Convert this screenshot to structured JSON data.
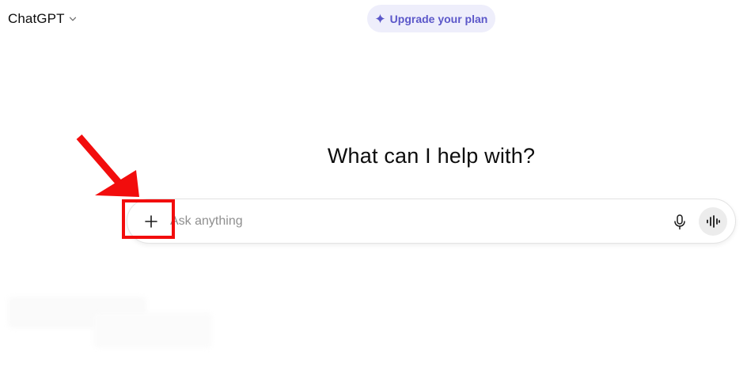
{
  "header": {
    "model_name": "ChatGPT",
    "model_icon": "chevron-down-icon",
    "upgrade_label": "Upgrade your plan",
    "upgrade_icon": "sparkle-icon",
    "upgrade_bg": "#eeeefb",
    "upgrade_color": "#5b57c9"
  },
  "main": {
    "title": "What can I help with?"
  },
  "composer": {
    "placeholder": "Ask anything",
    "value": "",
    "plus_icon": "plus-icon",
    "mic_icon": "microphone-icon",
    "voice_icon": "voice-mode-icon"
  },
  "annotation": {
    "color": "#f20d0d",
    "target": "plus-button"
  }
}
